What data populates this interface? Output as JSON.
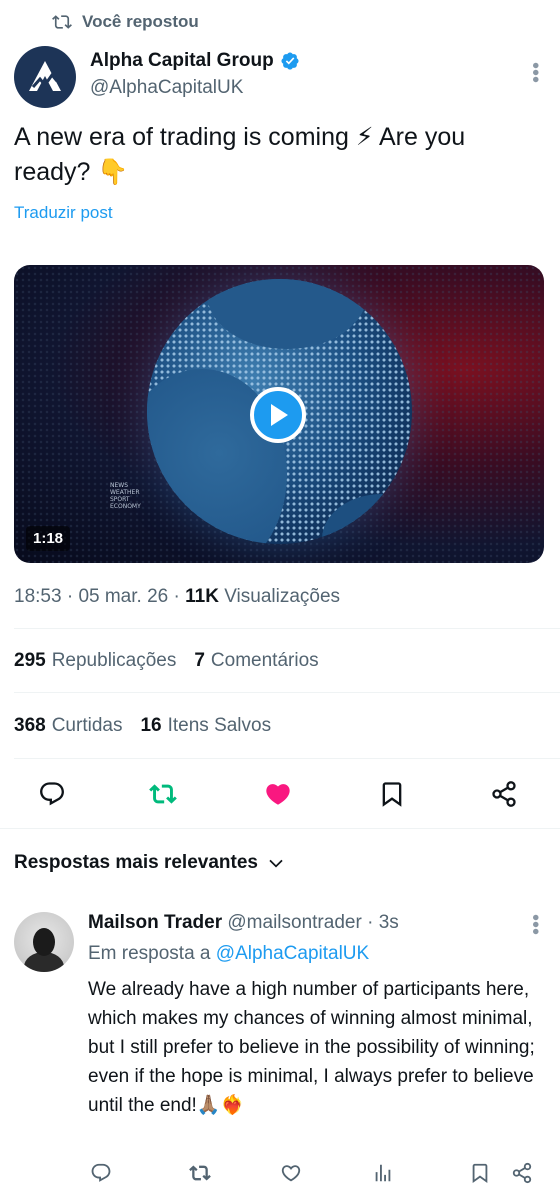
{
  "repost": {
    "label": "Você repostou"
  },
  "tweet": {
    "author_name": "Alpha Capital Group",
    "author_handle": "@AlphaCapitalUK",
    "text": "A new era of trading is coming ⚡ Are you ready? 👇",
    "translate_label": "Traduzir post",
    "video": {
      "duration": "1:18",
      "overlay_text": [
        "NEWS",
        "WEATHER",
        "SPORT",
        "ECONOMY"
      ]
    },
    "time": "18:53",
    "date": "05 mar. 26",
    "views_count": "11K",
    "views_label": "Visualizações"
  },
  "stats": {
    "reposts_count": "295",
    "reposts_label": "Republicações",
    "comments_count": "7",
    "comments_label": "Comentários",
    "likes_count": "368",
    "likes_label": "Curtidas",
    "saved_count": "16",
    "saved_label": "Itens Salvos"
  },
  "colors": {
    "accent": "#1d9bf0",
    "repost_active": "#00ba7c",
    "like_active": "#f91880",
    "muted": "#536471"
  },
  "replies_section": {
    "label": "Respostas mais relevantes"
  },
  "reply": {
    "author_name": "Mailson Trader",
    "author_handle": "@mailsontrader",
    "time": "3s",
    "in_reply_prefix": "Em resposta a",
    "in_reply_mention": "@AlphaCapitalUK",
    "text": "We already have a high number of participants here, which makes my chances of winning almost minimal, but I still prefer to believe in the possibility of winning; even if the hope is minimal, I always prefer to believe until the end!🙏🏽❤️‍🔥"
  }
}
